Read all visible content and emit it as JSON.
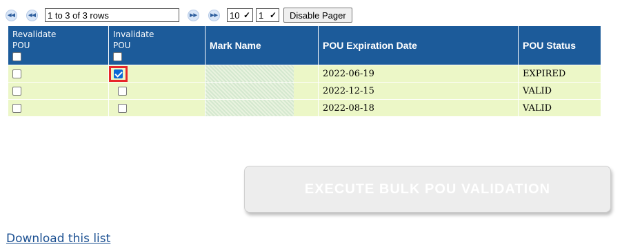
{
  "pager": {
    "rows_text": "1 to 3 of 3 rows",
    "page_size": "10",
    "page_number": "1",
    "disable_label": "Disable Pager"
  },
  "columns": [
    "Revalidate POU",
    "Invalidate POU",
    "Mark Name",
    "POU Expiration Date",
    "POU Status"
  ],
  "rows": [
    {
      "revalidate": false,
      "invalidate": true,
      "mark": "",
      "expiration": "2022-06-19",
      "status": "EXPIRED"
    },
    {
      "revalidate": false,
      "invalidate": false,
      "mark": "",
      "expiration": "2022-12-15",
      "status": "VALID"
    },
    {
      "revalidate": false,
      "invalidate": false,
      "mark": "",
      "expiration": "2022-08-18",
      "status": "VALID"
    }
  ],
  "execute_label": "EXECUTE BULK POU VALIDATION",
  "download_label": "Download this list",
  "colors": {
    "header": "#1c5b9a",
    "row": "#ecf7c7",
    "highlight": "#e8262a",
    "link": "#1a4f91"
  }
}
